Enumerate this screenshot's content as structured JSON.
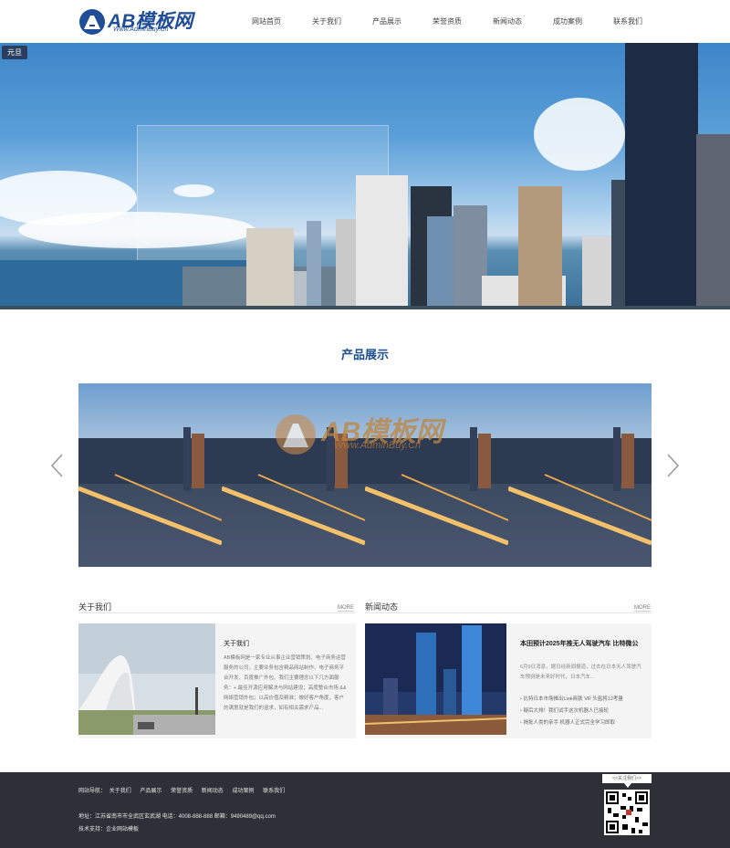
{
  "header": {
    "logo_text": "AB模板网",
    "logo_sub": "Www.AdminBuy.Cn",
    "nav": [
      "网站首页",
      "关于我们",
      "产品展示",
      "荣誉资质",
      "新闻动态",
      "成功案例",
      "联系我们"
    ]
  },
  "banner": {
    "tag": "元旦"
  },
  "products": {
    "title": "产品展示",
    "watermark_text": "AB模板网",
    "watermark_sub": "Www.AdminBuy.Cn"
  },
  "about": {
    "heading": "关于我们",
    "more": "MORE",
    "title": "关于我们",
    "body": "AB模板网是一家专业从事企业营销策划、电子商务运营服务的公司，主要业务包含精品网站制作、电子商务平台开发、百度推广外包、我们主要理念以下几方面服务：+.最佳开源应用解决与网站建设；高度整合市场 && 网络营销外包；以高价值及精准；做好客户角度，客户的满意就是我们的追求，如有相关需求产品..."
  },
  "news": {
    "heading": "新闻动态",
    "more": "MORE",
    "title": "本田预计2025年推无人驾驶汽车 比特微公",
    "desc": "6月9日消息，据日经新闻报道，过去在日本无人驾驶汽车预测是未来好时代，日本汽车...",
    "items": [
      "比特日本市场推出Link商铁 VR 头盔将12考量",
      "疑后大排！我们试手这次机器人已接轮",
      "揭批人类的亲手 机器人正式完全学习即取"
    ]
  },
  "footer": {
    "nav": [
      "网站导航：",
      "关于我们",
      "产品展示",
      "荣誉资质",
      "新闻动态",
      "成功案例",
      "联系我们"
    ],
    "info": "地址：江苏省南市市全武区玄武湖 电话：4008-888-888 邮箱：9490489@qq.com",
    "tech": "技术支持：企业网站模板",
    "qr_label": "<<关注我们>>"
  },
  "colors": {
    "accent": "#1e4f8f",
    "footer_bg": "#2f2f38",
    "card_bg": "#f4f4f4"
  },
  "icons": [
    "logo-mark-icon",
    "chevron-left-icon",
    "chevron-right-icon",
    "qr-code-icon"
  ]
}
